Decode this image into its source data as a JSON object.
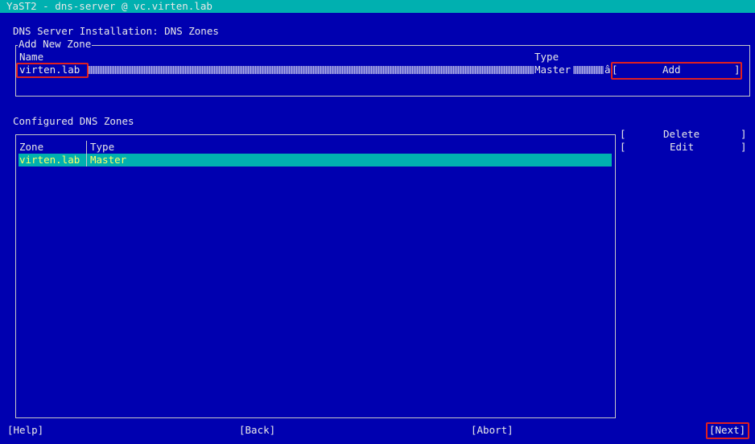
{
  "window": {
    "title": "YaST2 - dns-server @ vc.virten.lab"
  },
  "page": {
    "heading": "DNS Server Installation: DNS Zones"
  },
  "add_zone": {
    "group_label": "Add New Zone",
    "name_label": "Name",
    "name_value": "virten.lab",
    "type_label": "Type",
    "type_value": "Master",
    "type_arrow": "â",
    "add_button": "Add"
  },
  "configured": {
    "label": "Configured DNS Zones",
    "columns": [
      "Zone",
      "Type"
    ],
    "rows": [
      {
        "zone": "virten.lab",
        "type": "Master"
      }
    ]
  },
  "side_buttons": {
    "delete": "Delete",
    "edit": "Edit"
  },
  "footer": {
    "help": "[Help]",
    "back": "[Back]",
    "abort": "[Abort]",
    "next": "[Next]"
  },
  "colors": {
    "background": "#0000b0",
    "titlebar": "#00b0b0",
    "highlight": "#ffff66",
    "annotation": "#e02020"
  }
}
